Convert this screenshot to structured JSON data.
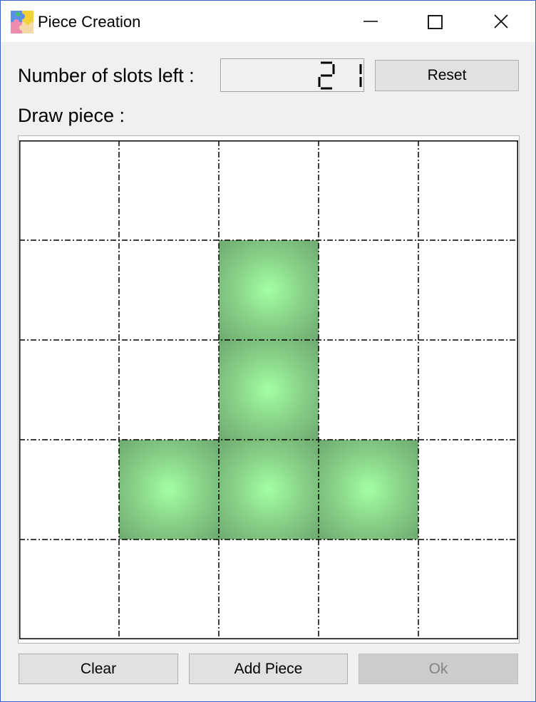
{
  "window": {
    "title": "Piece Creation",
    "app_icon": "puzzle-icon",
    "controls": [
      "minimize-icon",
      "maximize-icon",
      "close-icon"
    ]
  },
  "slots": {
    "label": "Number of slots left :",
    "value": "21"
  },
  "reset_button": "Reset",
  "draw_label": "Draw piece :",
  "grid": {
    "rows": 5,
    "cols": 5,
    "filled_cells": [
      [
        1,
        2
      ],
      [
        2,
        2
      ],
      [
        3,
        1
      ],
      [
        3,
        2
      ],
      [
        3,
        3
      ]
    ],
    "fill_color": "#a3ffa3"
  },
  "buttons": {
    "clear": "Clear",
    "add_piece": "Add Piece",
    "ok": "Ok"
  },
  "colors": {
    "window_border": "#3c5fd1",
    "ok_disabled_text": "#838383"
  }
}
